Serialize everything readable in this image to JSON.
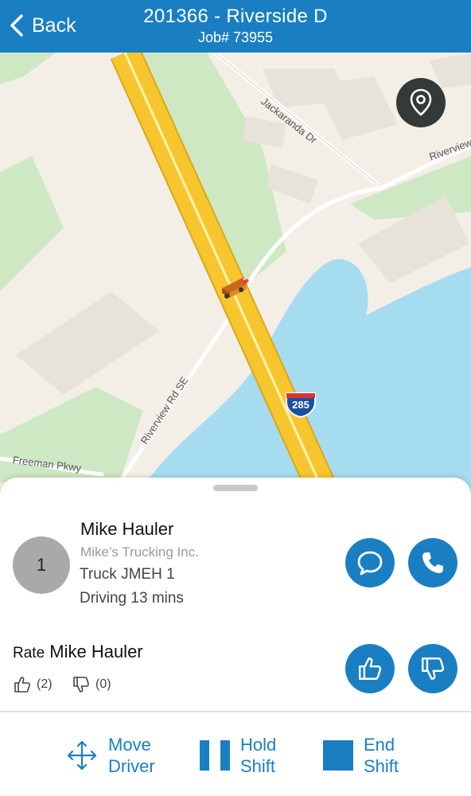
{
  "header": {
    "back_label": "Back",
    "title": "201366 - Riverside D",
    "subtitle": "Job# 73955",
    "background": "#1a7fc2"
  },
  "map": {
    "labels": {
      "jackaranda": "Jackaranda Dr",
      "riverview_top": "Riverview",
      "riverview_rd": "Riverview Rd SE",
      "freeman": "Freeman Pkwy"
    },
    "highway_shield": "285",
    "location_button_icon": "map-pin-icon"
  },
  "driver": {
    "position": "1",
    "name": "Mike Hauler",
    "company": "Mike’s Trucking Inc.",
    "truck": "Truck JMEH 1",
    "status": "Driving 13 mins",
    "message_icon": "chat-bubble-icon",
    "call_icon": "phone-icon"
  },
  "rating": {
    "label": "Rate",
    "name": "Mike Hauler",
    "up_count": "(2)",
    "down_count": "(0)"
  },
  "actions": {
    "move_line1": "Move",
    "move_line2": "Driver",
    "hold_line1": "Hold",
    "hold_line2": "Shift",
    "end_line1": "End",
    "end_line2": "Shift"
  },
  "colors": {
    "accent": "#1a7fc2",
    "avatar": "#a9a9a9",
    "water": "#a6dcf0",
    "park": "#cfe8c4",
    "highway": "#f7c62f"
  }
}
